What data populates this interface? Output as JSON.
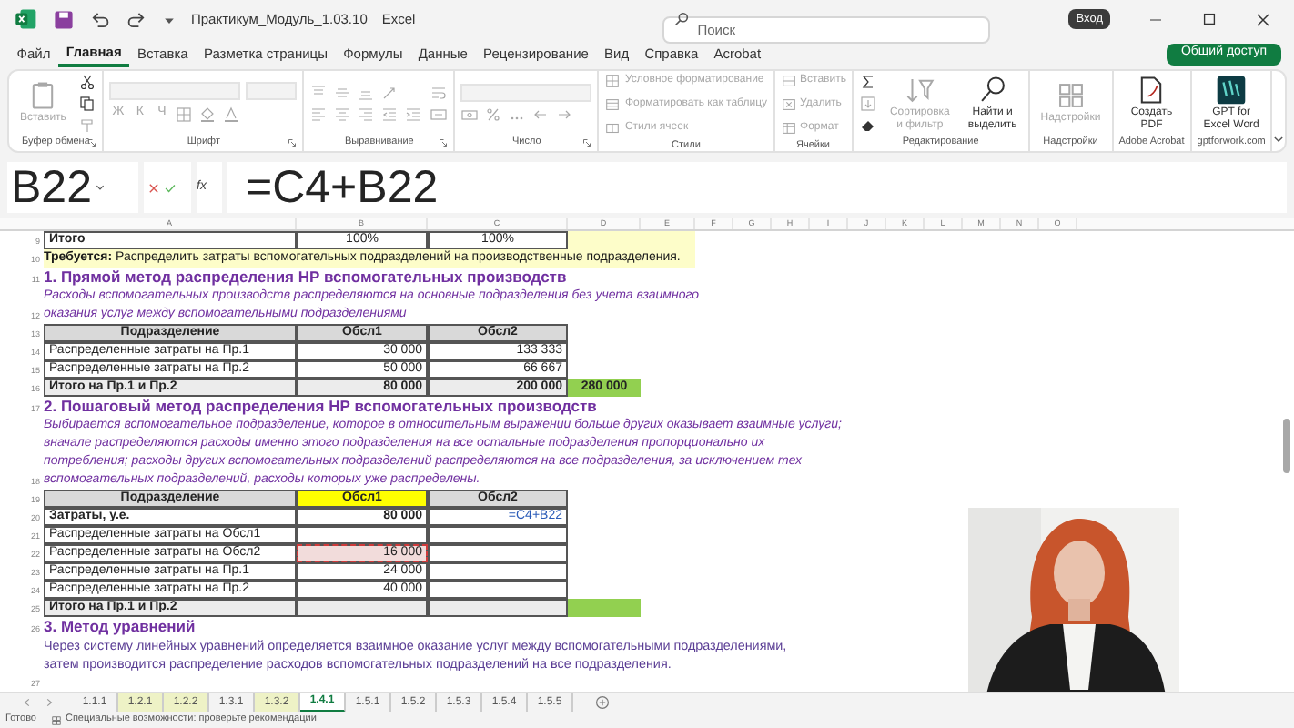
{
  "title_bar": {
    "document": "Практикум_Модуль_1.03.10",
    "app": "Excel",
    "search_placeholder": "Поиск",
    "sign_in": "Вход"
  },
  "menu_tabs": [
    {
      "label": "Файл",
      "selected": false
    },
    {
      "label": "Главная",
      "selected": true
    },
    {
      "label": "Вставка",
      "selected": false
    },
    {
      "label": "Разметка страницы",
      "selected": false
    },
    {
      "label": "Формулы",
      "selected": false
    },
    {
      "label": "Данные",
      "selected": false
    },
    {
      "label": "Рецензирование",
      "selected": false
    },
    {
      "label": "Вид",
      "selected": false
    },
    {
      "label": "Справка",
      "selected": false
    },
    {
      "label": "Acrobat",
      "selected": false
    }
  ],
  "share_button": "Общий доступ",
  "ribbon": [
    {
      "label": "Буфер обмена",
      "launcher": true,
      "columns": [
        [
          {
            "kind": "large",
            "label": "Вставить",
            "disabled": true
          }
        ],
        [
          {
            "kind": "icon",
            "disabled": false
          },
          {
            "kind": "icon",
            "disabled": false
          },
          {
            "kind": "icon",
            "disabled": true
          }
        ]
      ]
    },
    {
      "label": "Шрифт",
      "launcher": true,
      "columns": [
        [
          {
            "kind": "row",
            "items": [
              {
                "kind": "wide-field",
                "disabled": true
              },
              {
                "kind": "narrow-field",
                "disabled": true
              }
            ]
          },
          {
            "kind": "row",
            "items": [
              {
                "kind": "letter",
                "label": "Ж",
                "disabled": true
              },
              {
                "kind": "letter",
                "label": "К",
                "disabled": true
              },
              {
                "kind": "letter",
                "label": "Ч",
                "disabled": true
              },
              {
                "kind": "icon",
                "disabled": true
              },
              {
                "kind": "icon",
                "disabled": true
              },
              {
                "kind": "icon",
                "disabled": true
              }
            ]
          }
        ]
      ]
    },
    {
      "label": "Выравнивание",
      "launcher": true,
      "columns": [
        [
          {
            "kind": "row",
            "items": [
              {
                "kind": "icon",
                "disabled": true
              },
              {
                "kind": "icon",
                "disabled": true
              },
              {
                "kind": "icon",
                "disabled": true
              },
              {
                "kind": "icon",
                "disabled": true
              }
            ]
          },
          {
            "kind": "row",
            "items": [
              {
                "kind": "icon",
                "disabled": true
              },
              {
                "kind": "icon",
                "disabled": true
              },
              {
                "kind": "icon",
                "disabled": true
              },
              {
                "kind": "icon",
                "disabled": true
              },
              {
                "kind": "icon",
                "disabled": true
              }
            ]
          }
        ],
        [
          {
            "kind": "icon",
            "disabled": true
          },
          {
            "kind": "icon",
            "disabled": true
          }
        ]
      ]
    },
    {
      "label": "Число",
      "launcher": true,
      "columns": [
        [
          {
            "kind": "row",
            "items": [
              {
                "kind": "wide-field",
                "disabled": true
              }
            ]
          },
          {
            "kind": "row",
            "items": [
              {
                "kind": "icon",
                "disabled": true
              },
              {
                "kind": "icon",
                "disabled": true
              },
              {
                "kind": "icon",
                "disabled": true
              },
              {
                "kind": "icon",
                "disabled": true
              },
              {
                "kind": "icon",
                "disabled": true
              }
            ]
          }
        ]
      ]
    },
    {
      "label": "Стили",
      "launcher": false,
      "columns": [
        [
          {
            "kind": "small",
            "label": "Условное форматирование",
            "disabled": true
          },
          {
            "kind": "small",
            "label": "Форматировать как таблицу",
            "disabled": true
          },
          {
            "kind": "small",
            "label": "Стили ячеек",
            "disabled": true
          }
        ]
      ]
    },
    {
      "label": "Ячейки",
      "launcher": false,
      "columns": [
        [
          {
            "kind": "small",
            "label": "Вставить",
            "disabled": true
          },
          {
            "kind": "small",
            "label": "Удалить",
            "disabled": true
          },
          {
            "kind": "small",
            "label": "Формат",
            "disabled": true
          }
        ]
      ]
    },
    {
      "label": "Редактирование",
      "launcher": false,
      "columns": [
        [
          {
            "kind": "icon",
            "disabled": false
          },
          {
            "kind": "icon",
            "disabled": true
          },
          {
            "kind": "icon",
            "disabled": false
          }
        ],
        [
          {
            "kind": "large",
            "label": "Сортировка\nи фильтр",
            "disabled": true
          }
        ],
        [
          {
            "kind": "large",
            "label": "Найти и\nвыделить",
            "disabled": false
          }
        ]
      ]
    },
    {
      "label": "Надстройки",
      "launcher": false,
      "columns": [
        [
          {
            "kind": "large",
            "label": "Надстройки",
            "disabled": true
          }
        ]
      ]
    },
    {
      "label": "Adobe Acrobat",
      "launcher": false,
      "columns": [
        [
          {
            "kind": "large",
            "label": "Создать\nPDF",
            "disabled": false
          }
        ]
      ]
    },
    {
      "label": "gptforwork.com",
      "launcher": false,
      "columns": [
        [
          {
            "kind": "large",
            "label": "GPT for\nExcel Word",
            "disabled": false
          }
        ]
      ]
    }
  ],
  "formula_bar": {
    "name_box": "B22",
    "fx": "fx",
    "formula": "=C4+B22"
  },
  "column_headers": [
    "A",
    "B",
    "C",
    "D",
    "E",
    "F",
    "G",
    "H",
    "I",
    "J",
    "K",
    "L",
    "M",
    "N",
    "O"
  ],
  "rows": [
    {
      "kind": "percent",
      "num": "9",
      "cells": [
        {
          "text": "Итого",
          "bold": true,
          "boxed": true
        },
        {
          "text": "100%",
          "bold": false,
          "boxed": true
        },
        {
          "text": "100%",
          "bold": false,
          "boxed": true
        },
        {
          "boxed": false,
          "color": "#fdfdc9"
        },
        {
          "boxed": false,
          "color": "#fdfdc9"
        }
      ]
    },
    {
      "kind": "banner",
      "num": "10",
      "text": "**Требуется:** Распределить затраты вспомогательных подразделений на производственные подразделения."
    },
    {
      "kind": "heading",
      "num": "11",
      "text": "1. Прямой метод распределения НР вспомогательных производств"
    },
    {
      "kind": "italic",
      "num": "12",
      "text": "Расходы вспомогательных производств распределяются на основные подразделения без учета взаимного\nоказания услуг между вспомогательными подразделениями"
    },
    {
      "kind": "header",
      "num": "13",
      "cells": [
        {
          "text": "Подразделение",
          "bold": true,
          "boxed": true,
          "color": "#d9d9d9"
        },
        {
          "text": "Обсл1",
          "bold": true,
          "boxed": true,
          "color": "#d9d9d9"
        },
        {
          "text": "Обсл2",
          "bold": true,
          "boxed": true,
          "color": "#d9d9d9"
        }
      ]
    },
    {
      "kind": "cells",
      "num": "14",
      "cells": [
        {
          "text": "Распределенные затраты на Пр.1",
          "bold": false,
          "boxed": true
        },
        {
          "text": "30 000",
          "bold": false,
          "boxed": true
        },
        {
          "text": "133 333",
          "bold": false,
          "boxed": true
        }
      ]
    },
    {
      "kind": "cells",
      "num": "15",
      "cells": [
        {
          "text": "Распределенные затраты на Пр.2",
          "bold": false,
          "boxed": true
        },
        {
          "text": "50 000",
          "bold": false,
          "boxed": true
        },
        {
          "text": "66 667",
          "bold": false,
          "boxed": true
        }
      ]
    },
    {
      "kind": "cells",
      "num": "16",
      "cells": [
        {
          "text": "Итого на Пр.1 и Пр.2",
          "bold": true,
          "boxed": true,
          "color": "#ececec"
        },
        {
          "text": "80 000",
          "bold": true,
          "boxed": true,
          "color": "#ececec"
        },
        {
          "text": "200 000",
          "bold": true,
          "boxed": true,
          "color": "#ececec"
        },
        {
          "text": "280 000",
          "bold": true,
          "boxed": false,
          "color": "#92d050"
        }
      ]
    },
    {
      "kind": "heading",
      "num": "17",
      "text": "2. Пошаговый метод распределения НР вспомогательных производств"
    },
    {
      "kind": "italic",
      "num": "18",
      "text": "Выбирается вспомогательное подразделение, которое в относительным выражении больше других оказывает взаимные услуги;\nвначале распределяются расходы именно этого подразделения на все остальные подразделения пропорционально их\nпотребления; расходы других вспомогательных подразделений распределяются на все подразделения, за исключением тех\nвспомогательных подразделений, расходы которых уже распределены."
    },
    {
      "kind": "header",
      "num": "19",
      "cells": [
        {
          "text": "Подразделение",
          "bold": true,
          "boxed": true,
          "color": "#d9d9d9"
        },
        {
          "text": "Обсл1",
          "bold": true,
          "boxed": true,
          "color": "#ffff00"
        },
        {
          "text": "Обсл2",
          "bold": true,
          "boxed": true,
          "color": "#d9d9d9"
        }
      ]
    },
    {
      "kind": "cells",
      "num": "20",
      "cells": [
        {
          "text": "Затраты, у.е.",
          "bold": true,
          "boxed": true
        },
        {
          "text": "80 000",
          "bold": true,
          "boxed": true
        },
        {
          "text": "=C4+B22",
          "bold": false,
          "boxed": true,
          "editing": true
        }
      ]
    },
    {
      "kind": "cells",
      "num": "21",
      "cells": [
        {
          "text": "Распределенные затраты на Обсл1",
          "bold": false,
          "boxed": true
        },
        {
          "boxed": true
        },
        {
          "boxed": true
        }
      ]
    },
    {
      "kind": "cells",
      "num": "22",
      "cells": [
        {
          "text": "Распределенные затраты на Обсл2",
          "bold": false,
          "boxed": true
        },
        {
          "text": "16 000",
          "bold": false,
          "boxed": true,
          "color": "#f2dcdb",
          "referenced": true
        },
        {
          "boxed": true
        }
      ]
    },
    {
      "kind": "cells",
      "num": "23",
      "cells": [
        {
          "text": "Распределенные затраты на Пр.1",
          "bold": false,
          "boxed": true
        },
        {
          "text": "24 000",
          "bold": false,
          "boxed": true
        },
        {
          "boxed": true
        }
      ]
    },
    {
      "kind": "cells",
      "num": "24",
      "cells": [
        {
          "text": "Распределенные затраты на Пр.2",
          "bold": false,
          "boxed": true
        },
        {
          "text": "40 000",
          "bold": false,
          "boxed": true
        },
        {
          "boxed": true
        }
      ]
    },
    {
      "kind": "cells",
      "num": "25",
      "cells": [
        {
          "text": "Итого на Пр.1 и Пр.2",
          "bold": true,
          "boxed": true,
          "color": "#ececec"
        },
        {
          "boxed": true,
          "color": "#ececec"
        },
        {
          "boxed": true,
          "color": "#ececec"
        },
        {
          "boxed": false,
          "color": "#92d050"
        }
      ]
    },
    {
      "kind": "heading",
      "num": "26",
      "text": "3. Метод уравнений"
    },
    {
      "kind": "plain",
      "text": "Через систему линейных уравнений определяется взаимное оказание услуг между вспомогательными подразделениями,\nзатем производится распределение расходов вспомогательных подразделений на все подразделения."
    },
    {
      "kind": "blank",
      "num": "27"
    }
  ],
  "sheet_tabs": [
    {
      "label": "1.1.1",
      "selected": false
    },
    {
      "label": "1.2.1",
      "selected": false,
      "color": "#eef2c6"
    },
    {
      "label": "1.2.2",
      "selected": false,
      "color": "#eef2c6"
    },
    {
      "label": "1.3.1",
      "selected": false
    },
    {
      "label": "1.3.2",
      "selected": false,
      "color": "#eef2c6"
    },
    {
      "label": "1.4.1",
      "selected": true
    },
    {
      "label": "1.5.1",
      "selected": false
    },
    {
      "label": "1.5.2",
      "selected": false
    },
    {
      "label": "1.5.3",
      "selected": false
    },
    {
      "label": "1.5.4",
      "selected": false
    },
    {
      "label": "1.5.5",
      "selected": false
    }
  ],
  "status_bar": {
    "mode": "Готово",
    "accessibility": "Специальные возможности: проверьте рекомендации"
  }
}
